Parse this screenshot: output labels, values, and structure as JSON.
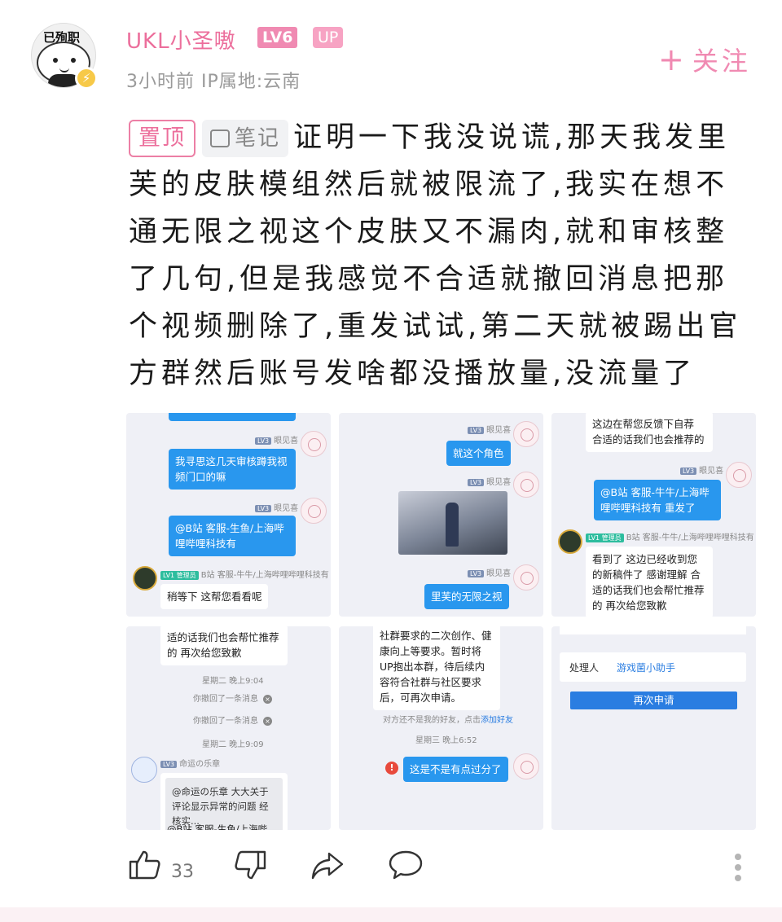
{
  "header": {
    "avatar_text": "已殉职",
    "username": "UKL小圣嗷",
    "level": "LV6",
    "up_badge": "UP",
    "meta": "3小时前  IP属地:云南",
    "follow_label": "关注"
  },
  "post": {
    "pin_tag": "置顶",
    "note_tag": "笔记",
    "text": "证明一下我没说谎,那天我发里芙的皮肤模组然后就被限流了,我实在想不通无限之视这个皮肤又不漏肉,就和审核整了几句,但是我感觉不合适就撤回消息把那个视频删除了,重发试试,第二天就被踢出官方群然后账号发啥都没播放量,没流量了"
  },
  "screenshots": {
    "s1": {
      "nick1": "眼见喜",
      "msg1": "我寻思这几天审核蹲我视频门口的嘛",
      "nick2": "眼见喜",
      "msg2": "@B站 客服-生鱼/上海哔哩哔哩科技有",
      "mod_role": "管理员",
      "mod_nick": "B站 客服-牛牛/上海哔哩哔哩科技有",
      "msg3": "稍等下 这帮您看看呢"
    },
    "s2": {
      "nick1": "眼见喜",
      "msg1": "就这个角色",
      "nick2": "眼见喜",
      "nick3": "眼见喜",
      "msg3": "里芙的无限之视"
    },
    "s3": {
      "msg0": "这边在帮您反馈下自荐 合适的话我们也会推荐的",
      "nick1": "眼见喜",
      "msg1": "@B站 客服-牛牛/上海哔哩哔哩科技有 重发了",
      "mod_role": "管理员",
      "mod_nick": "B站 客服-牛牛/上海哔哩哔哩科技有",
      "msg2": "看到了 这边已经收到您的新稿件了 感谢理解 合适的话我们也会帮忙推荐的 再次给您致歉"
    },
    "s4": {
      "msg0": "适的话我们也会帮忙推荐的 再次给您致歉",
      "time1": "星期二 晚上9:04",
      "recall1": "你撤回了一条消息",
      "recall2": "你撤回了一条消息",
      "time2": "星期二 晚上9:09",
      "nick": "命运の乐章",
      "card": "@命运の乐章 大大关于评论显示异常的问题 经核实...",
      "cut": "@B站 客服-生鱼/上海哔"
    },
    "s5": {
      "msg0": "社群要求的二次创作、健康向上等要求。暂时将UP抱出本群，待后续内容符合社群与社区要求后，可再次申请。",
      "notice_a": "对方还不是我的好友，点击",
      "notice_b": "添加好友",
      "time": "星期三 晚上6:52",
      "msg1": "这是不是有点过分了"
    },
    "s6": {
      "handler_key": "处理人",
      "handler_val": "游戏菌小助手",
      "reapply": "再次申请"
    },
    "level_tag": "LV3",
    "mod_level_tag": "LV1"
  },
  "actions": {
    "like_count": "33"
  },
  "icons": [
    "thumbs-up-icon",
    "thumbs-down-icon",
    "share-icon",
    "comment-icon",
    "more-icon"
  ],
  "colors": {
    "accent_pink": "#ec6f9c",
    "bubble_blue": "#2997ee",
    "text": "#1a1a1a"
  }
}
